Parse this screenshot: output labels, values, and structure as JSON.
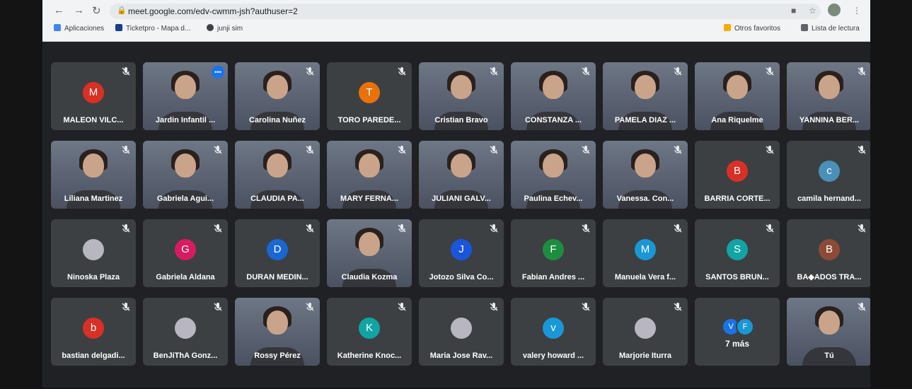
{
  "browser": {
    "url": "meet.google.com/edv-cwmm-jsh?authuser=2",
    "bookmarks": [
      "Aplicaciones",
      "Ticketpro - Mapa d...",
      "junji sim"
    ],
    "other_favorites": "Otros favoritos",
    "reading_list": "Lista de lectura"
  },
  "participants": [
    {
      "name": "MALEON VILC...",
      "initial": "M",
      "color": "#d93025",
      "video": false
    },
    {
      "name": "Jardin Infantil ...",
      "video": true,
      "speaking": true
    },
    {
      "name": "Carolina Nuñez",
      "video": true
    },
    {
      "name": "TORO PAREDE...",
      "initial": "T",
      "color": "#e8710a",
      "video": false
    },
    {
      "name": "Cristian Bravo",
      "video": true
    },
    {
      "name": "CONSTANZA ...",
      "video": true
    },
    {
      "name": "PAMELA DIAZ ...",
      "video": true
    },
    {
      "name": "Ana Riquelme",
      "video": true
    },
    {
      "name": "YANNINA BER...",
      "video": true
    },
    {
      "name": "Liliana Martinez",
      "video": true
    },
    {
      "name": "Gabriela Agui...",
      "video": true
    },
    {
      "name": "CLAUDIA PA...",
      "video": true
    },
    {
      "name": "MARY FERNA...",
      "video": true
    },
    {
      "name": "JULIANI GALV...",
      "video": true
    },
    {
      "name": "Paulina Echev...",
      "video": true
    },
    {
      "name": "Vanessa. Con...",
      "video": true
    },
    {
      "name": "BARRIA CORTE...",
      "initial": "B",
      "color": "#d93025",
      "video": false
    },
    {
      "name": "camila hernand...",
      "initial": "c",
      "color": "#4a90b8",
      "video": false
    },
    {
      "name": "Ninoska Plaza",
      "photo": true,
      "video": false
    },
    {
      "name": "Gabriela Aldana",
      "initial": "G",
      "color": "#d81b60",
      "video": false
    },
    {
      "name": "DURAN MEDIN...",
      "initial": "D",
      "color": "#1967d2",
      "video": false
    },
    {
      "name": "Claudia Kozma",
      "video": true
    },
    {
      "name": "Jotozo Silva Co...",
      "initial": "J",
      "color": "#1a56db",
      "video": false
    },
    {
      "name": "Fabian Andres ...",
      "initial": "F",
      "color": "#1e8e3e",
      "video": false
    },
    {
      "name": "Manuela Vera f...",
      "initial": "M",
      "color": "#1a97d6",
      "video": false
    },
    {
      "name": "SANTOS BRUN...",
      "initial": "S",
      "color": "#12a4a4",
      "video": false
    },
    {
      "name": "BA◆ADOS TRA...",
      "initial": "B",
      "color": "#8d4b37",
      "video": false
    },
    {
      "name": "bastian delgadi...",
      "initial": "b",
      "color": "#d93025",
      "video": false
    },
    {
      "name": "BenJiThA Gonz...",
      "photo": true,
      "video": false
    },
    {
      "name": "Rossy Pérez",
      "video": true
    },
    {
      "name": "Katherine Knoc...",
      "initial": "K",
      "color": "#12a4a4",
      "video": false
    },
    {
      "name": "Maria Jose Rav...",
      "photo": true,
      "video": false
    },
    {
      "name": "valery howard ...",
      "initial": "v",
      "color": "#1a97d6",
      "video": false
    },
    {
      "name": "Marjorie Iturra",
      "photo": true,
      "video": false
    },
    {
      "more": true,
      "label": "7 más",
      "initials": [
        "V",
        "F"
      ],
      "colors": [
        "#1a73e8",
        "#1a97d6"
      ]
    },
    {
      "name": "Tú",
      "video": true,
      "self": true
    }
  ]
}
